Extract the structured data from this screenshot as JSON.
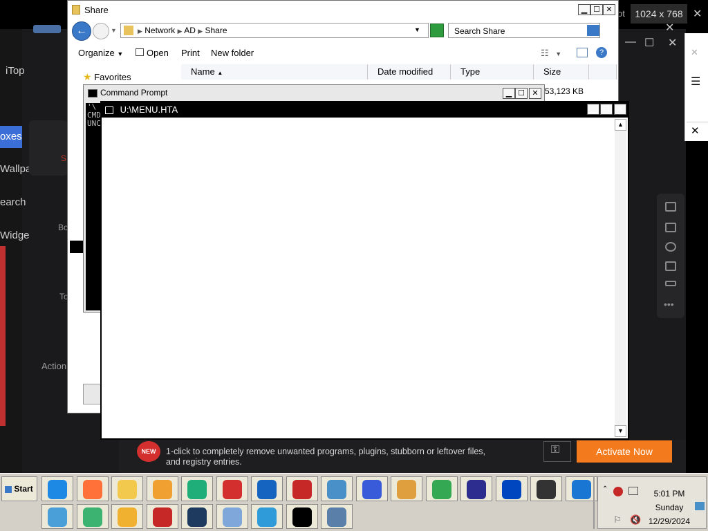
{
  "screen": {
    "resolution_badge": "1024 x 768",
    "partial_label": "ot"
  },
  "bg_app": {
    "name_partial": "iTop",
    "nav": [
      "oxes",
      "Wallpa",
      "earch",
      "Widge"
    ],
    "mid_labels": [
      "S",
      "Bo",
      "To",
      "Action"
    ]
  },
  "explorer": {
    "title": "Share",
    "breadcrumb": [
      "Network",
      "AD",
      "Share"
    ],
    "search_placeholder": "Search Share",
    "commands": {
      "organize": "Organize",
      "open": "Open",
      "print": "Print",
      "new_folder": "New folder"
    },
    "favorites": "Favorites",
    "columns": {
      "name": "Name",
      "date": "Date modified",
      "type": "Type",
      "size": "Size"
    },
    "row_size": "53,123 KB"
  },
  "cmd": {
    "title": "Command Prompt",
    "lines": [
      "'\\",
      "CMD",
      "UNC"
    ]
  },
  "hta": {
    "title": "U:\\MENU.HTA"
  },
  "promo": {
    "badge": "NEW",
    "text": "1-click to completely remove unwanted programs, plugins, stubborn or leftover files, and registry entries.",
    "button": "Activate Now"
  },
  "taskbar": {
    "start": "Start",
    "clock": {
      "time": "5:01 PM",
      "day": "Sunday",
      "date": "12/29/2024"
    },
    "icons_row1": [
      {
        "name": "ie-icon",
        "color": "#1e88e5"
      },
      {
        "name": "firefox-icon",
        "color": "#ff7139"
      },
      {
        "name": "folder-icon",
        "color": "#f2c94c"
      },
      {
        "name": "media-player-icon",
        "color": "#f0a030"
      },
      {
        "name": "green-swirl-icon",
        "color": "#1fae7a"
      },
      {
        "name": "red-gear-icon",
        "color": "#d32f2f"
      },
      {
        "name": "shield-icon",
        "color": "#1565c0"
      },
      {
        "name": "video-record-icon",
        "color": "#c62828"
      },
      {
        "name": "remote-desktop-icon",
        "color": "#4a90c8"
      },
      {
        "name": "bird-icon",
        "color": "#3a5bd9"
      },
      {
        "name": "paint-icon",
        "color": "#e09f3e"
      },
      {
        "name": "chrome-icon",
        "color": "#34a853"
      },
      {
        "name": "infinity-icon",
        "color": "#2d2d8f"
      },
      {
        "name": "best-buy-icon",
        "color": "#0046be"
      },
      {
        "name": "blackberry-icon",
        "color": "#333333"
      },
      {
        "name": "edge-icon",
        "color": "#1976d2"
      }
    ],
    "icons_row2": [
      {
        "name": "recycle-bin-icon",
        "color": "#4a9fd8"
      },
      {
        "name": "box-3d-icon",
        "color": "#3cb371"
      },
      {
        "name": "play-icon",
        "color": "#f0b030"
      },
      {
        "name": "flash-icon",
        "color": "#c62828"
      },
      {
        "name": "tiles-icon",
        "color": "#1e3a5f"
      },
      {
        "name": "document-icon",
        "color": "#7fa7d9"
      },
      {
        "name": "send-icon",
        "color": "#2f9bd9"
      },
      {
        "name": "cmd-icon",
        "color": "#000000"
      },
      {
        "name": "window-icon",
        "color": "#5a7fa8"
      }
    ]
  }
}
